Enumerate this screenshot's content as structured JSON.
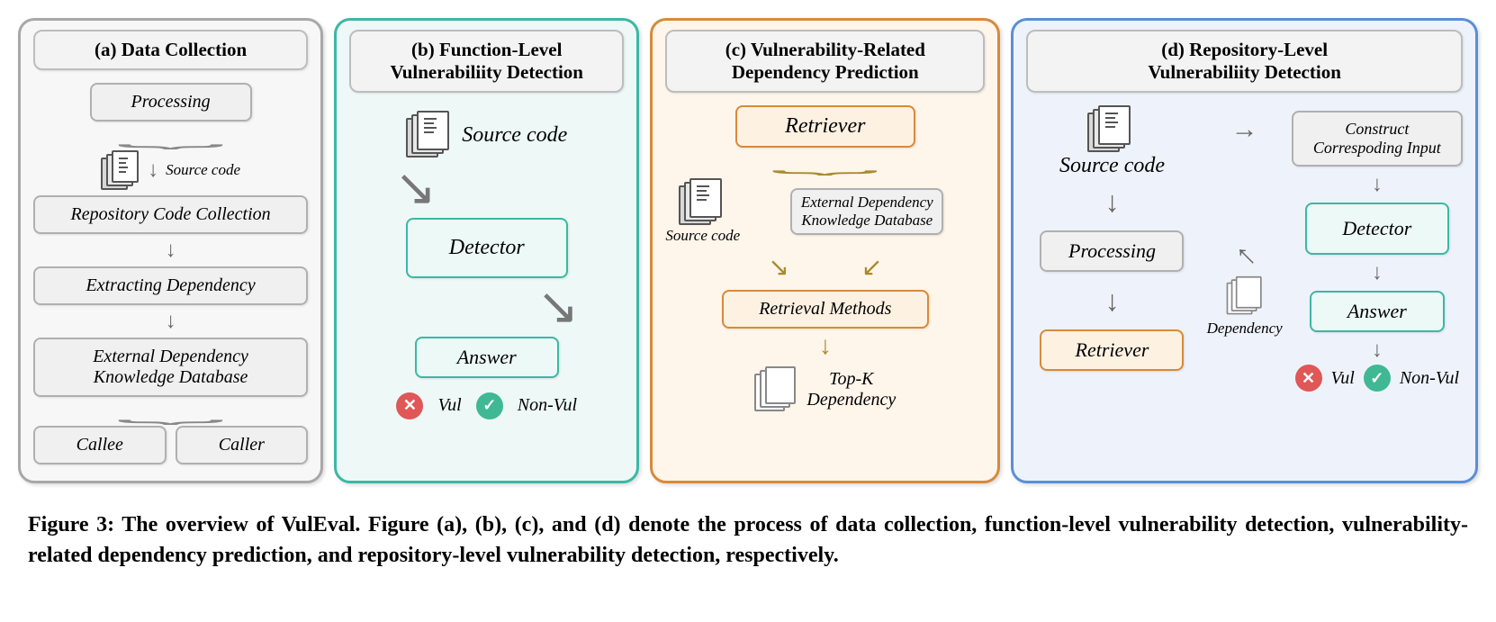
{
  "panel_a": {
    "title": "(a) Data Collection",
    "processing": "Processing",
    "source_code": "Source code",
    "repo_collection": "Repository Code Collection",
    "extracting": "Extracting Dependency",
    "db": "External Dependency\nKnowledge Database",
    "callee": "Callee",
    "caller": "Caller"
  },
  "panel_b": {
    "title": "(b) Function-Level\nVulnerabiliity Detection",
    "source_code": "Source code",
    "detector": "Detector",
    "answer": "Answer",
    "vul": "Vul",
    "nonvul": "Non-Vul"
  },
  "panel_c": {
    "title": "(c) Vulnerability-Related\nDependency Prediction",
    "retriever": "Retriever",
    "source_code": "Source code",
    "db": "External Dependency\nKnowledge Database",
    "methods": "Retrieval  Methods",
    "topk": "Top-K\nDependency"
  },
  "panel_d": {
    "title": "(d) Repository-Level\nVulnerabiliity Detection",
    "source_code": "Source code",
    "processing": "Processing",
    "retriever": "Retriever",
    "dependency": "Dependency",
    "construct": "Construct\nCorrespoding Input",
    "detector": "Detector",
    "answer": "Answer",
    "vul": "Vul",
    "nonvul": "Non-Vul"
  },
  "caption": "Figure 3: The overview of VulEval. Figure (a), (b), (c), and (d) denote the process of data collection, function-level vulnerability detection, vulnerability-related dependency prediction, and repository-level vulnerability detection, respectively."
}
